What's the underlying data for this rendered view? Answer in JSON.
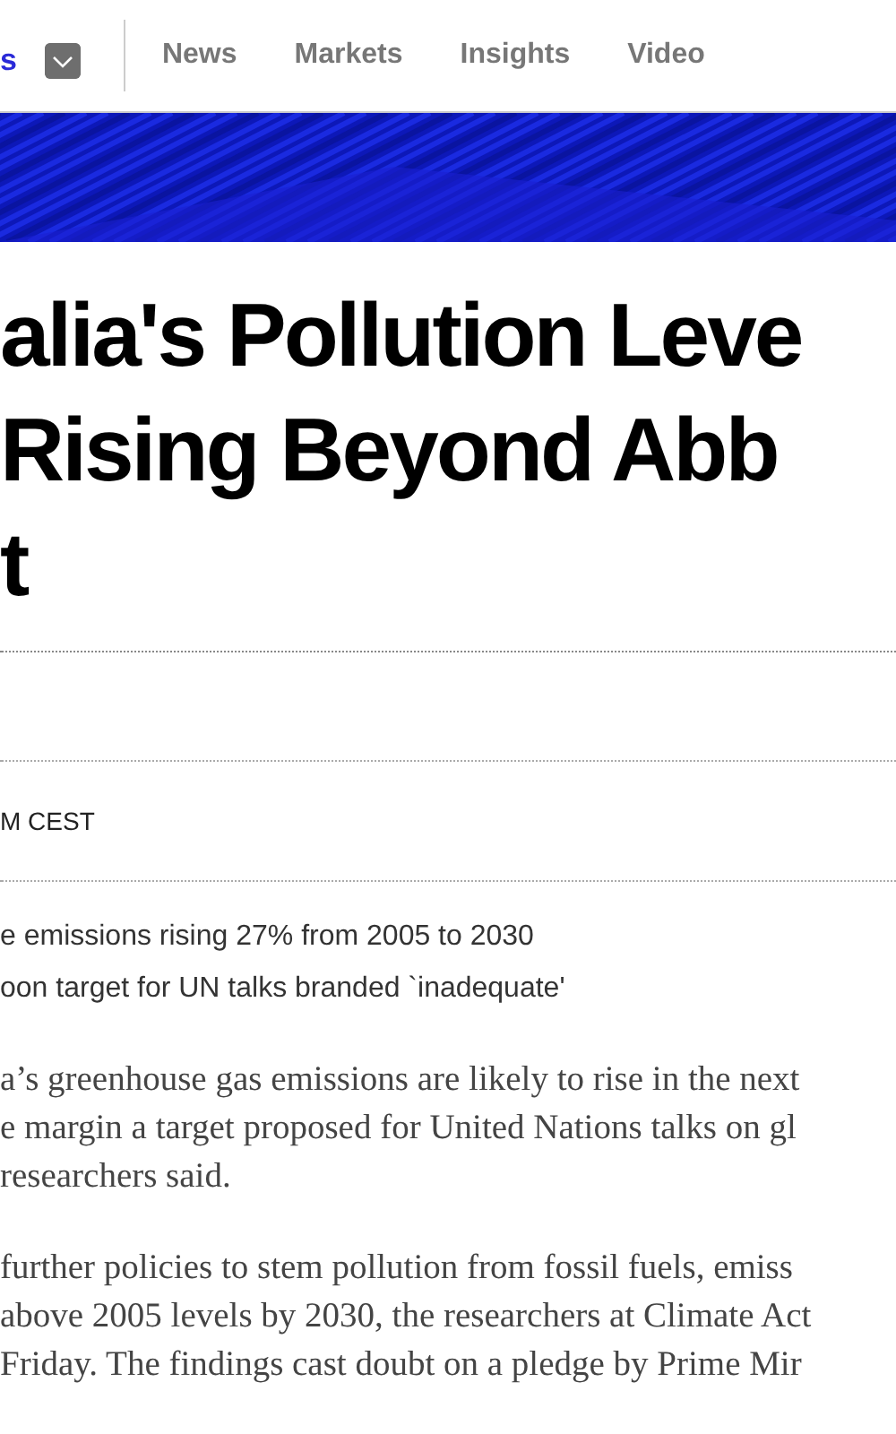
{
  "nav": {
    "logo_fragment": "s",
    "links": [
      "News",
      "Markets",
      "Insights",
      "Video"
    ]
  },
  "banner": {
    "kind": "picture"
  },
  "headline": [
    "alia's Pollution Leve",
    "Rising Beyond Abb",
    "t"
  ],
  "timestamp": "M CEST",
  "bullets": [
    "e emissions rising 27% from 2005 to 2030",
    "oon target for UN talks branded `inadequate'"
  ],
  "paragraphs": [
    {
      "lines": [
        "a’s greenhouse gas emissions are likely to rise in the next",
        "e margin a target proposed for United Nations talks on gl",
        "researchers said."
      ]
    },
    {
      "lines": [
        "further policies to stem pollution from fossil fuels, emiss",
        "above 2005 levels by 2030, the researchers at Climate Act",
        "Friday. The findings cast doubt on a pledge by Prime Mir"
      ]
    }
  ]
}
